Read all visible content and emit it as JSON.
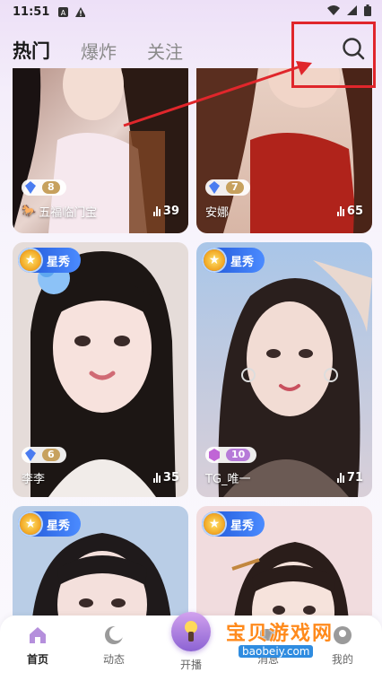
{
  "status_bar": {
    "time": "11:51"
  },
  "tabs": [
    {
      "label": "热门",
      "active": true
    },
    {
      "label": "爆炸",
      "active": false
    },
    {
      "label": "关注",
      "active": false
    }
  ],
  "search": {
    "icon": "search-icon"
  },
  "cards": [
    {
      "name": "五福临门宝",
      "level": "8",
      "level_color": "gold",
      "viewers": "39",
      "has_star_badge": false,
      "name_icon": "horse-icon"
    },
    {
      "name": "安娜",
      "level": "7",
      "level_color": "gold",
      "viewers": "65",
      "has_star_badge": false
    },
    {
      "name": "李李",
      "level": "6",
      "level_color": "gold",
      "viewers": "35",
      "has_star_badge": true,
      "badge_label": "星秀"
    },
    {
      "name": "TG_唯一",
      "level": "10",
      "level_color": "purple",
      "viewers": "71",
      "has_star_badge": true,
      "badge_label": "星秀"
    },
    {
      "name": "",
      "level": "",
      "viewers": "",
      "has_star_badge": true,
      "badge_label": "星秀"
    },
    {
      "name": "",
      "level": "",
      "viewers": "",
      "has_star_badge": true,
      "badge_label": "星秀"
    }
  ],
  "bottom_nav": [
    {
      "label": "首页",
      "icon": "home-icon",
      "active": true
    },
    {
      "label": "动态",
      "icon": "moon-icon",
      "active": false
    },
    {
      "label": "开播",
      "icon": "live-torch-icon",
      "active": false
    },
    {
      "label": "消息",
      "icon": "message-icon",
      "active": false
    },
    {
      "label": "我的",
      "icon": "profile-icon",
      "active": false
    }
  ],
  "watermark": {
    "text": "宝贝游戏网",
    "url": "baobeiy.com"
  },
  "colors": {
    "accent": "#e0262b",
    "badge_blue": "#2f6be0",
    "live_button": "#a779e0"
  }
}
